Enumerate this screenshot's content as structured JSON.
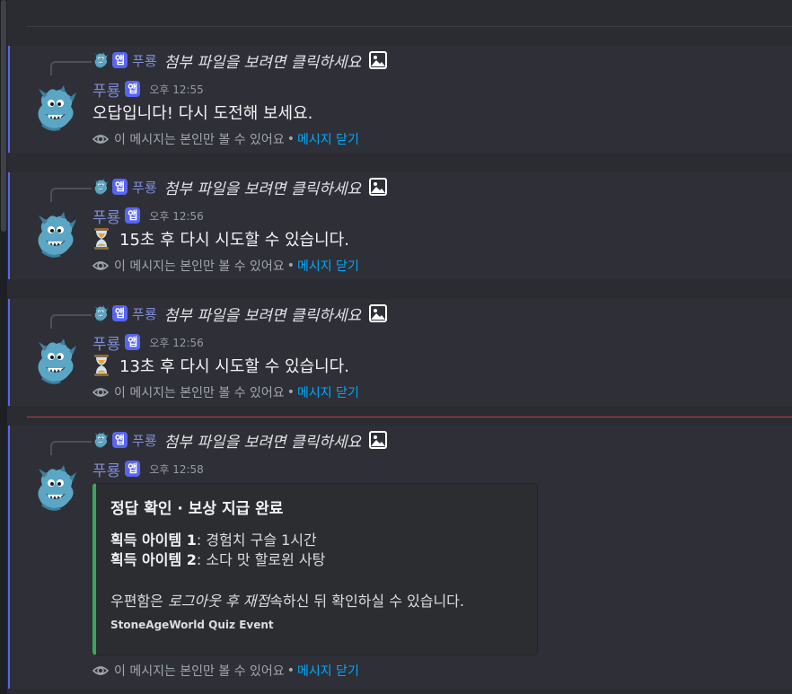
{
  "app_badge": "앱",
  "messages": [
    {
      "reply_author": "푸룡",
      "reply_text": "첨부 파일을 보려면 클릭하세요",
      "author": "푸룡",
      "timestamp": "오후 12:55",
      "content": "오답입니다! 다시 도전해 보세요.",
      "has_hourglass": false
    },
    {
      "reply_author": "푸룡",
      "reply_text": "첨부 파일을 보려면 클릭하세요",
      "author": "푸룡",
      "timestamp": "오후 12:56",
      "content": "15초 후 다시 시도할 수 있습니다.",
      "has_hourglass": true
    },
    {
      "reply_author": "푸룡",
      "reply_text": "첨부 파일을 보려면 클릭하세요",
      "author": "푸룡",
      "timestamp": "오후 12:56",
      "content": "13초 후 다시 시도할 수 있습니다.",
      "has_hourglass": true
    },
    {
      "reply_author": "푸룡",
      "reply_text": "첨부 파일을 보려면 클릭하세요",
      "author": "푸룡",
      "timestamp": "오후 12:58"
    }
  ],
  "ephemeral": {
    "notice": "이 메시지는 본인만 볼 수 있어요",
    "separator": "•",
    "dismiss": "메시지 닫기"
  },
  "embed": {
    "title": "정답 확인 · 보상 지급 완료",
    "item1_label": "획득 아이템 1",
    "item1_value": ": 경험치 구슬 1시간",
    "item2_label": "획득 아이템 2",
    "item2_value": ": 소다 맛 할로윈 사탕",
    "mail_prefix": "우편함은 ",
    "mail_italic": "로그아웃 후 재접",
    "mail_suffix": "속하신 뒤 확인하실 수 있습니다.",
    "footer": "StoneAgeWorld Quiz Event"
  },
  "colors": {
    "accent": "#5865f2",
    "author": "#7f8cd6",
    "link": "#00a8fc",
    "embed_bar": "#3ba55d",
    "new_divider": "#e2434b"
  },
  "icons": [
    "dragon-avatar-icon",
    "image-icon",
    "eye-icon",
    "hourglass-icon"
  ]
}
